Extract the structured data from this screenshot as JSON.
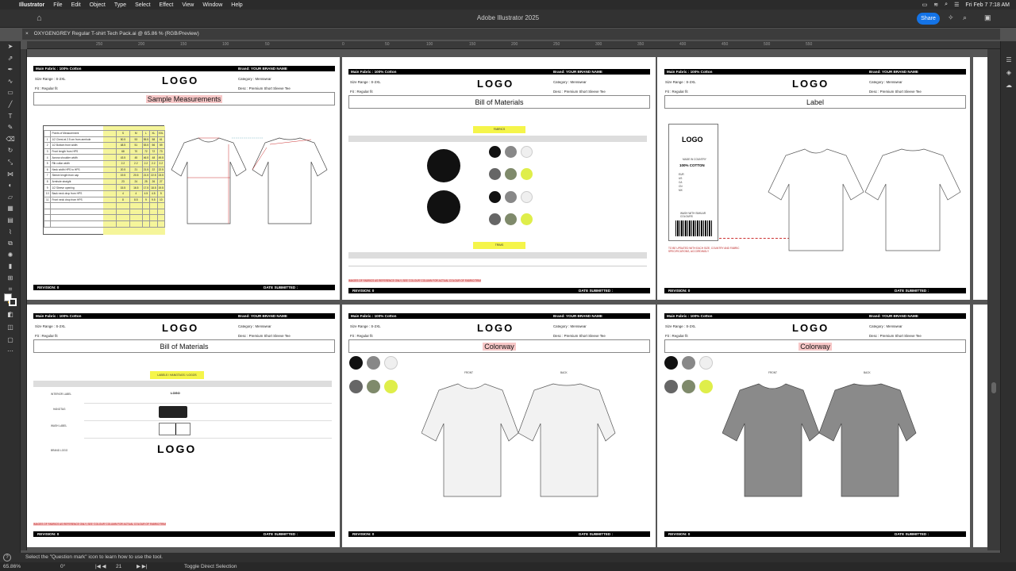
{
  "menubar": {
    "app": "Illustrator",
    "items": [
      "File",
      "Edit",
      "Object",
      "Type",
      "Select",
      "Effect",
      "View",
      "Window",
      "Help"
    ],
    "datetime": "Fri Feb 7  7:18 AM"
  },
  "titlebar": {
    "title": "Adobe Illustrator 2025",
    "share": "Share"
  },
  "doc_tab": {
    "close": "×",
    "name": "OXYGENGREY Regular T-shirt Tech Pack.ai @ 65.86 % (RGB/Preview)"
  },
  "ruler": {
    "ticks": [
      "250",
      "200",
      "150",
      "100",
      "50",
      "0",
      "50",
      "100",
      "150",
      "200",
      "250",
      "300",
      "350",
      "400",
      "450",
      "500",
      "550"
    ]
  },
  "status": {
    "hint": "Select the \"Question mark\" icon to learn how to use the tool."
  },
  "bottom": {
    "zoom": "65.86%",
    "angle": "0°",
    "artboard": "21",
    "tool": "Toggle Direct Selection"
  },
  "common": {
    "main_fabric": "Main Fabric : 100% Cotton",
    "brand": "Brand: YOUR BRAND NAME",
    "size_range": "Size Range : S-2XL",
    "category": "Category : Menswear",
    "fit": "Fit :   Regular fit",
    "desc": "Desc : Premium Short Sleeve Tee",
    "logo": "LOGO",
    "revision": "REVISION: 0",
    "date_submitted": "DATE SUBMITTED :",
    "reference_note": "IMAGES OF FABRICS AS REFERENCE ONLY, SEE 'COLOUR' COLUMN FOR ACTUAL COLOUR OF FABRIC/TRIM"
  },
  "artboards": {
    "a1": {
      "title": "Sample Measurements"
    },
    "a2": {
      "title": "Bill of Materials",
      "fabrics": "FABRICS",
      "trims": "TRIMS"
    },
    "a3": {
      "title": "Label",
      "label_lines": [
        "MADE IN COUNTRY",
        "100% COTTON"
      ],
      "sizes": [
        "EUR",
        "US",
        "CA",
        "CN",
        "MX"
      ],
      "care": "WASH WITH SIMILAR COLOURS",
      "note": "TO BE UPDATED WITH EACH SIZE, COUNTRY AND FABRIC SPECIFICATIONS, ACCORDINGLY"
    },
    "a4": {
      "title": "Bill of Materials",
      "header": "LABELS / HANGTAGS / LOGOS",
      "rows": [
        "INTERIOR LABEL",
        "HANGTAG",
        "WASH LABEL",
        "BRAND LOGO"
      ]
    },
    "a5": {
      "title": "Colorway",
      "front": "FRONT",
      "back": "BACK"
    },
    "a6": {
      "title": "Colorway",
      "front": "FRONT",
      "back": "BACK"
    }
  },
  "measurements": {
    "headers": [
      "",
      "Points of Measurement",
      "S",
      "M",
      "L",
      "XL",
      "XXL"
    ],
    "rows": [
      [
        "1",
        "1/2 Chest at 2.5 cm from armhole",
        "50.5",
        "53",
        "55.5",
        "58",
        "61"
      ],
      [
        "2",
        "1/2 Bottom from width",
        "48.5",
        "51",
        "53.5",
        "56",
        "59"
      ],
      [
        "3",
        "Front length from HPS",
        "68",
        "70",
        "72",
        "72",
        "73"
      ],
      [
        "4",
        "Across shoulder width",
        "43.5",
        "45",
        "46.5",
        "48",
        "49.5"
      ],
      [
        "5",
        "Rib collar width",
        "2.2",
        "2.2",
        "2.2",
        "2.2",
        "2.2"
      ],
      [
        "6",
        "Neck width HPS to HPS",
        "20.5",
        "21",
        "21.5",
        "22",
        "22.5"
      ],
      [
        "7",
        "Sleeve length from cap",
        "19.5",
        "20.5",
        "21.5",
        "22.5",
        "23.5"
      ],
      [
        "8",
        "Armhole straight",
        "23",
        "24",
        "25",
        "26",
        "27"
      ],
      [
        "9",
        "1/2 Sleeve opening",
        "15.5",
        "16.5",
        "17.5",
        "18.5",
        "19.5"
      ],
      [
        "10",
        "Back neck drop from HPS",
        "4",
        "4",
        "4.5",
        "4.5",
        "5"
      ],
      [
        "11",
        "Front neck drop from HPS",
        "8",
        "8.5",
        "9",
        "9.5",
        "10"
      ]
    ]
  },
  "colors": {
    "accent": "#1473e6",
    "highlight": "#f5f54a",
    "swatches": [
      "#111111",
      "#888888",
      "#efefef",
      "#666666",
      "#7f8a6b",
      "#dfee4a"
    ]
  }
}
